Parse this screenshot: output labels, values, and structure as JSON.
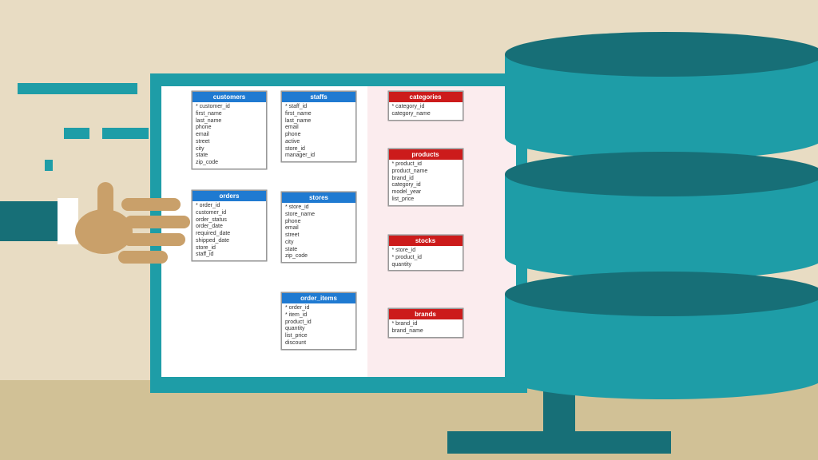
{
  "tables": {
    "customers": {
      "title": "customers",
      "fields": [
        "* customer_id",
        "first_name",
        "last_name",
        "phone",
        "email",
        "street",
        "city",
        "state",
        "zip_code"
      ]
    },
    "orders": {
      "title": "orders",
      "fields": [
        "* order_id",
        "customer_id",
        "order_status",
        "order_date",
        "required_date",
        "shipped_date",
        "store_id",
        "staff_id"
      ]
    },
    "staffs": {
      "title": "staffs",
      "fields": [
        "* staff_id",
        "first_name",
        "last_name",
        "email",
        "phone",
        "active",
        "store_id",
        "manager_id"
      ]
    },
    "stores": {
      "title": "stores",
      "fields": [
        "* store_id",
        "store_name",
        "phone",
        "email",
        "street",
        "city",
        "state",
        "zip_code"
      ]
    },
    "order_items": {
      "title": "order_items",
      "fields": [
        "* order_id",
        "* item_id",
        "product_id",
        "quantity",
        "list_price",
        "discount"
      ]
    },
    "categories": {
      "title": "categories",
      "fields": [
        "* category_id",
        "category_name"
      ]
    },
    "products": {
      "title": "products",
      "fields": [
        "* product_id",
        "product_name",
        "brand_id",
        "category_id",
        "model_year",
        "list_price"
      ]
    },
    "stocks": {
      "title": "stocks",
      "fields": [
        "* store_id",
        "* product_id",
        "quantity"
      ]
    },
    "brands": {
      "title": "brands",
      "fields": [
        "* brand_id",
        "brand_name"
      ]
    }
  },
  "colors": {
    "background": "#e8dcc3",
    "desk": "#d1c196",
    "teal": "#1e9da7",
    "darkTeal": "#176f77",
    "blueHeader": "#1f7ad1",
    "redHeader": "#cc1b1b",
    "skin": "#c9a06a"
  },
  "relationships": [
    [
      "customers",
      "orders"
    ],
    [
      "orders",
      "staffs"
    ],
    [
      "orders",
      "stores"
    ],
    [
      "orders",
      "order_items"
    ],
    [
      "staffs",
      "stores"
    ],
    [
      "staffs",
      "staffs"
    ],
    [
      "stores",
      "stocks"
    ],
    [
      "order_items",
      "products"
    ],
    [
      "products",
      "categories"
    ],
    [
      "products",
      "brands"
    ],
    [
      "products",
      "stocks"
    ]
  ]
}
